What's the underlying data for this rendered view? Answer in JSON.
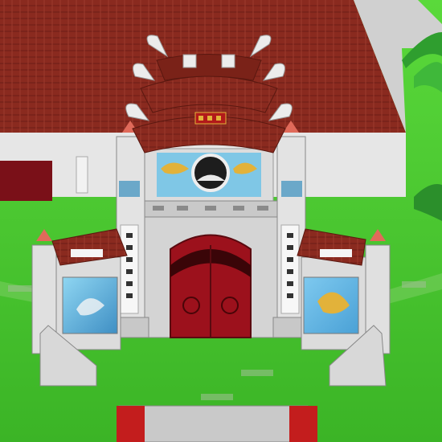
{
  "scene": {
    "title": "",
    "sign_plaque": "",
    "left_scroll": "",
    "right_scroll": ""
  },
  "colors": {
    "grass": "#4cc934",
    "roof_tile": "#8a2a1f",
    "wall": "#d9d9d9",
    "door": "#9c111c",
    "panel_left": "#63b7dc",
    "panel_right": "#6cc0e8",
    "stairs": "#c31d1d"
  },
  "icons": {
    "dragon_motif": "dragon-mural-icon",
    "phoenix_motif": "phoenix-mural-icon",
    "round_window": "round-window-icon",
    "flower_knob": "rosette-icon"
  }
}
